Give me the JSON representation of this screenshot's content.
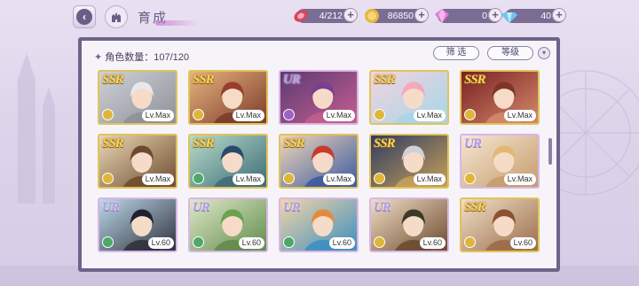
{
  "header": {
    "title": "育成",
    "resources": [
      {
        "name": "stamina",
        "value": "4/212",
        "icon": "candy-icon",
        "color": "#d9455b"
      },
      {
        "name": "coins",
        "value": "86850",
        "icon": "coin-icon",
        "color": "#e6b73a"
      },
      {
        "name": "gems-pink",
        "value": "0",
        "icon": "pink-gem-icon",
        "color": "#e07ad8"
      },
      {
        "name": "gems-blue",
        "value": "40",
        "icon": "blue-diamond-icon",
        "color": "#6ec6f0"
      }
    ],
    "plus": "+"
  },
  "panel": {
    "count_label": "角色数量：107/120",
    "filter_label": "筛 选",
    "sort_label": "等级",
    "collapse_glyph": "▾"
  },
  "cards": [
    {
      "rarity": "SSR",
      "level": "Lv.Max",
      "attr_color": "#e0b63a",
      "bg": [
        "#cfd3d8",
        "#8c8f96"
      ],
      "hair": "#e8e8ee"
    },
    {
      "rarity": "SSR",
      "level": "Lv.Max",
      "attr_color": "#e0b63a",
      "bg": [
        "#e7b47d",
        "#7a3a2a"
      ],
      "hair": "#9b3d2c"
    },
    {
      "rarity": "UR",
      "level": "Lv.Max",
      "attr_color": "#9a63c9",
      "bg": [
        "#5c3a74",
        "#c65f8f"
      ],
      "hair": "#7a3f8e"
    },
    {
      "rarity": "SSR",
      "level": "Lv.Max",
      "attr_color": "#e0b63a",
      "bg": [
        "#f4d3df",
        "#a4d6e8"
      ],
      "hair": "#f4a8bd"
    },
    {
      "rarity": "SSR",
      "level": "Lv.Max",
      "attr_color": "#e0b63a",
      "bg": [
        "#7a1f24",
        "#d58b6a"
      ],
      "hair": "#7d3526"
    },
    {
      "rarity": "SSR",
      "level": "Lv.Max",
      "attr_color": "#e0b63a",
      "bg": [
        "#e9d8b6",
        "#6d4a2d"
      ],
      "hair": "#6d4a2d"
    },
    {
      "rarity": "SSR",
      "level": "Lv.Max",
      "attr_color": "#4da86a",
      "bg": [
        "#b7dcc8",
        "#3c6a78"
      ],
      "hair": "#2b4a6b"
    },
    {
      "rarity": "SSR",
      "level": "Lv.Max",
      "attr_color": "#e0b63a",
      "bg": [
        "#f0d7b8",
        "#3a58a0"
      ],
      "hair": "#c73b2f"
    },
    {
      "rarity": "SSR",
      "level": "Lv.Max",
      "attr_color": "#e0b63a",
      "bg": [
        "#2f3a62",
        "#c7a25a"
      ],
      "hair": "#d0d0d6"
    },
    {
      "rarity": "UR",
      "level": "Lv.Max",
      "attr_color": "#e0b63a",
      "bg": [
        "#f6e6d4",
        "#c59b6a"
      ],
      "hair": "#e2b770"
    },
    {
      "rarity": "UR",
      "level": "Lv.60",
      "attr_color": "#4da86a",
      "bg": [
        "#bcd8ea",
        "#2f2f3a"
      ],
      "hair": "#1f2030"
    },
    {
      "rarity": "UR",
      "level": "Lv.60",
      "attr_color": "#4da86a",
      "bg": [
        "#dfe8c8",
        "#5f8a4a"
      ],
      "hair": "#6aa24f"
    },
    {
      "rarity": "UR",
      "level": "Lv.60",
      "attr_color": "#4da86a",
      "bg": [
        "#f4d4a8",
        "#3a8ec0"
      ],
      "hair": "#e58a3a"
    },
    {
      "rarity": "UR",
      "level": "Lv.60",
      "attr_color": "#e0b63a",
      "bg": [
        "#f0dcc4",
        "#6a4a2e"
      ],
      "hair": "#3b3a2a"
    },
    {
      "rarity": "SSR",
      "level": "Lv.60",
      "attr_color": "#e0b63a",
      "bg": [
        "#f0e0c8",
        "#9a6a48"
      ],
      "hair": "#8a5230"
    }
  ]
}
